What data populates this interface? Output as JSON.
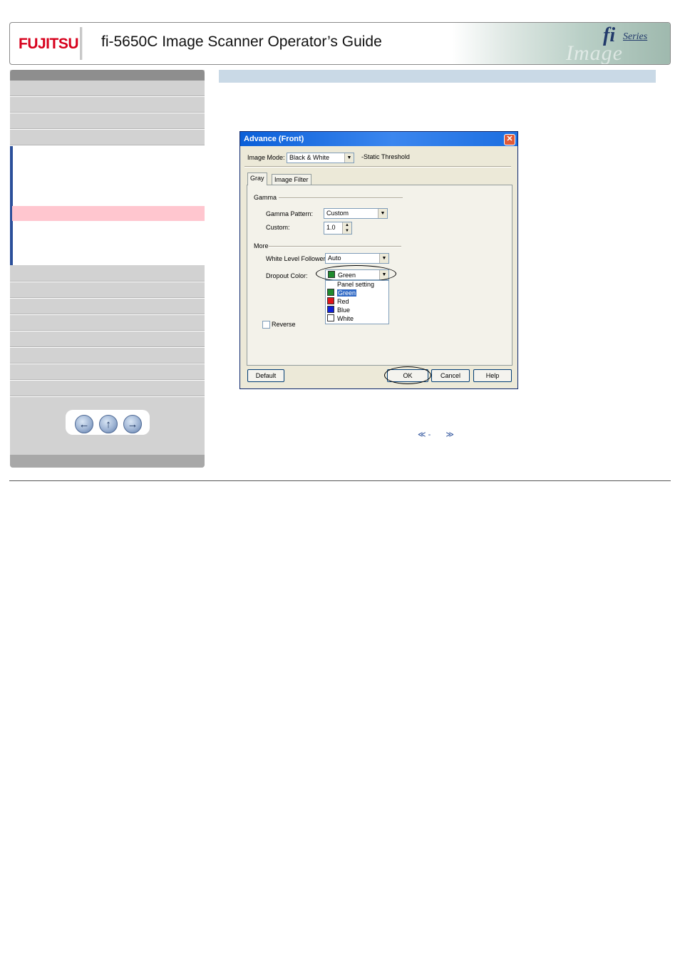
{
  "header": {
    "logo": "FUJITSU",
    "title": "fi-5650C Image Scanner Operator’s Guide",
    "series_mark": "fi",
    "series_word": "Series",
    "banner_ghost": "Image Scanner"
  },
  "sidebar": {
    "top_items": [
      "",
      "",
      "",
      ""
    ],
    "bottom_items": [
      "",
      "",
      "",
      "",
      "",
      "",
      "",
      ""
    ]
  },
  "dialog": {
    "title": "Advance (Front)",
    "close_glyph": "✕",
    "image_mode_label": "Image Mode:",
    "image_mode_value": "Black & White",
    "static_threshold": "-Static Threshold",
    "tabs": [
      "Gray",
      "Image Filter"
    ],
    "gamma_group": "Gamma",
    "gamma_pattern_label": "Gamma Pattern:",
    "gamma_pattern_value": "Custom",
    "custom_label": "Custom:",
    "custom_value": "1.0",
    "more_group": "More",
    "white_level_label": "White Level Follower:",
    "white_level_value": "Auto",
    "dropout_label": "Dropout Color:",
    "dropout_value": "Green",
    "dropout_options": [
      {
        "label": "Panel setting",
        "color": ""
      },
      {
        "label": "Green",
        "color": "#1f8a2e"
      },
      {
        "label": "Red",
        "color": "#e0141b"
      },
      {
        "label": "Blue",
        "color": "#1020d8"
      },
      {
        "label": "White",
        "color": "#ffffff"
      }
    ],
    "reverse_label": "Reverse",
    "buttons": {
      "default": "Default",
      "ok": "OK",
      "cancel": "Cancel",
      "help": "Help"
    }
  },
  "pager": {
    "prev": "≪ -",
    "next": "≫"
  },
  "colors": {
    "accent_red": "#d7001c",
    "highlight_pink": "#ffc6cf",
    "content_bar": "#c9d9e6"
  }
}
